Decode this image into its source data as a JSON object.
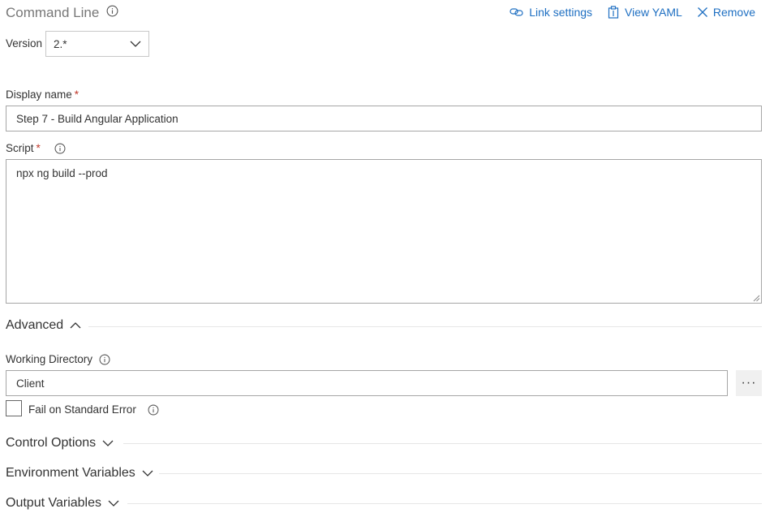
{
  "header": {
    "title": "Command Line",
    "actions": {
      "link_settings": "Link settings",
      "view_yaml": "View YAML",
      "remove": "Remove"
    }
  },
  "version": {
    "label": "Version",
    "value": "2.*"
  },
  "display_name": {
    "label": "Display name",
    "required_mark": "*",
    "value": "Step 7 - Build Angular Application"
  },
  "script": {
    "label": "Script",
    "required_mark": "*",
    "value": "npx ng build --prod"
  },
  "advanced": {
    "label": "Advanced",
    "working_directory": {
      "label": "Working Directory",
      "value": "Client",
      "browse_label": "···"
    },
    "fail_on_stderr": {
      "label": "Fail on Standard Error",
      "checked": false
    }
  },
  "sections": {
    "control_options": "Control Options",
    "environment_variables": "Environment Variables",
    "output_variables": "Output Variables"
  },
  "colors": {
    "accent": "#1e6fc2",
    "required": "#c0392b",
    "border": "#a6a6a6"
  }
}
